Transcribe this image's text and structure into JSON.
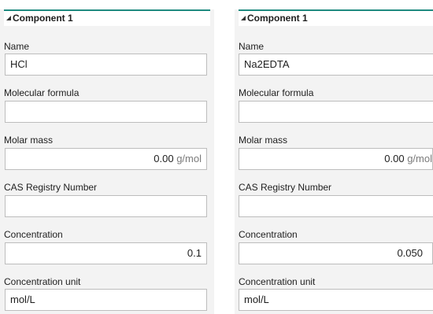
{
  "left": {
    "header": "Component 1",
    "name_label": "Name",
    "name_value": "HCl",
    "formula_label": "Molecular formula",
    "formula_value": "",
    "mass_label": "Molar mass",
    "mass_value": "0.00",
    "mass_unit": "g/mol",
    "cas_label": "CAS Registry Number",
    "cas_value": "",
    "conc_label": "Concentration",
    "conc_value": "0.1",
    "unit_label": "Concentration unit",
    "unit_value": "mol/L"
  },
  "right": {
    "header": "Component 1",
    "name_label": "Name",
    "name_value": "Na2EDTA",
    "formula_label": "Molecular formula",
    "formula_value": "",
    "mass_label": "Molar mass",
    "mass_value": "0.00",
    "mass_unit": "g/mol",
    "cas_label": "CAS Registry Number",
    "cas_value": "",
    "conc_label": "Concentration",
    "conc_value": "0.050",
    "unit_label": "Concentration unit",
    "unit_value": "mol/L"
  },
  "colors": {
    "header_accent": "#1f8a80",
    "panel_bg": "#f3f3f3",
    "unit_text": "#7a7a7a"
  }
}
